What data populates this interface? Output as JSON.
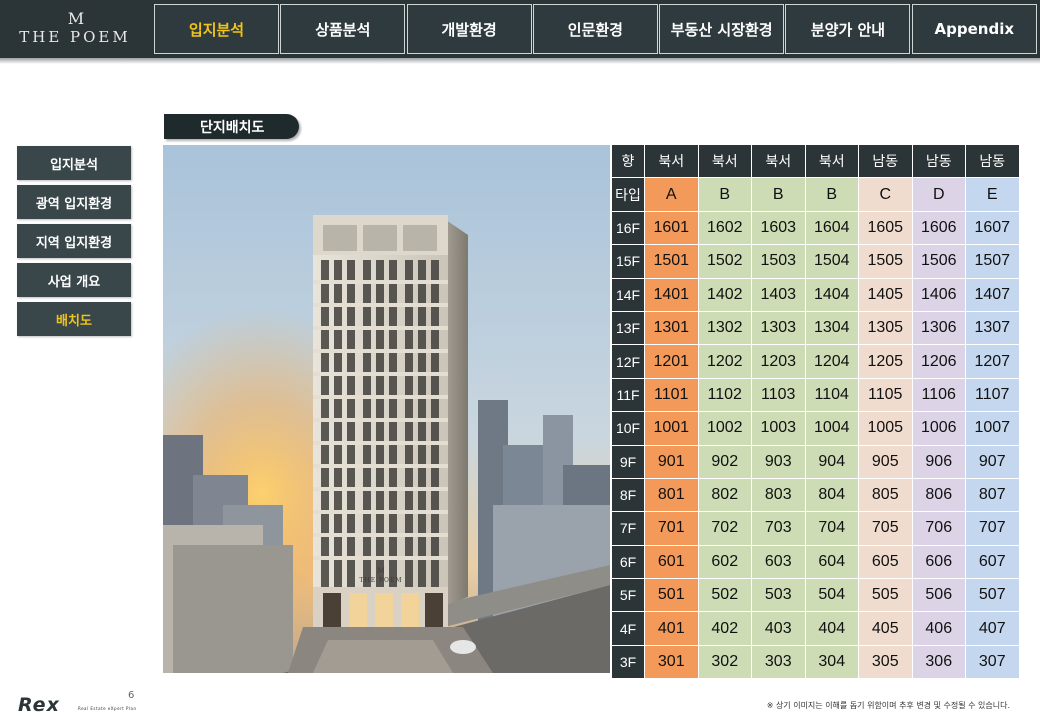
{
  "header": {
    "logo_mark": "M",
    "logo_text": "THE POEM",
    "nav": [
      {
        "label": "입지분석",
        "active": true
      },
      {
        "label": "상품분석",
        "active": false
      },
      {
        "label": "개발환경",
        "active": false
      },
      {
        "label": "인문환경",
        "active": false
      },
      {
        "label": "부동산 시장환경",
        "active": false
      },
      {
        "label": "분양가 안내",
        "active": false
      },
      {
        "label": "Appendix",
        "active": false
      }
    ]
  },
  "sidebar": {
    "items": [
      {
        "label": "입지분석",
        "active": false
      },
      {
        "label": "광역 입지환경",
        "active": false
      },
      {
        "label": "지역 입지환경",
        "active": false
      },
      {
        "label": "사업 개요",
        "active": false
      },
      {
        "label": "배치도",
        "active": true
      }
    ]
  },
  "section_title": "단지배치도",
  "photo": {
    "building_sign_mark": "M",
    "building_sign": "THE POEM"
  },
  "table": {
    "direction_label": "향",
    "type_label": "타입",
    "directions": [
      "북서",
      "북서",
      "북서",
      "북서",
      "남동",
      "남동",
      "남동"
    ],
    "types": [
      "A",
      "B",
      "B",
      "B",
      "C",
      "D",
      "E"
    ],
    "type_colors": {
      "A": "#f39a5a",
      "B": "#cddcb5",
      "C": "#f0dccf",
      "D": "#dcd4e6",
      "E": "#c4d7ef"
    },
    "floors": [
      {
        "floor": "16F",
        "units": [
          "1601",
          "1602",
          "1603",
          "1604",
          "1605",
          "1606",
          "1607"
        ]
      },
      {
        "floor": "15F",
        "units": [
          "1501",
          "1502",
          "1503",
          "1504",
          "1505",
          "1506",
          "1507"
        ]
      },
      {
        "floor": "14F",
        "units": [
          "1401",
          "1402",
          "1403",
          "1404",
          "1405",
          "1406",
          "1407"
        ]
      },
      {
        "floor": "13F",
        "units": [
          "1301",
          "1302",
          "1303",
          "1304",
          "1305",
          "1306",
          "1307"
        ]
      },
      {
        "floor": "12F",
        "units": [
          "1201",
          "1202",
          "1203",
          "1204",
          "1205",
          "1206",
          "1207"
        ]
      },
      {
        "floor": "11F",
        "units": [
          "1101",
          "1102",
          "1103",
          "1104",
          "1105",
          "1106",
          "1107"
        ]
      },
      {
        "floor": "10F",
        "units": [
          "1001",
          "1002",
          "1003",
          "1004",
          "1005",
          "1006",
          "1007"
        ]
      },
      {
        "floor": "9F",
        "units": [
          "901",
          "902",
          "903",
          "904",
          "905",
          "906",
          "907"
        ]
      },
      {
        "floor": "8F",
        "units": [
          "801",
          "802",
          "803",
          "804",
          "805",
          "806",
          "807"
        ]
      },
      {
        "floor": "7F",
        "units": [
          "701",
          "702",
          "703",
          "704",
          "705",
          "706",
          "707"
        ]
      },
      {
        "floor": "6F",
        "units": [
          "601",
          "602",
          "603",
          "604",
          "605",
          "606",
          "607"
        ]
      },
      {
        "floor": "5F",
        "units": [
          "501",
          "502",
          "503",
          "504",
          "505",
          "506",
          "507"
        ]
      },
      {
        "floor": "4F",
        "units": [
          "401",
          "402",
          "403",
          "404",
          "405",
          "406",
          "407"
        ]
      },
      {
        "floor": "3F",
        "units": [
          "301",
          "302",
          "303",
          "304",
          "305",
          "306",
          "307"
        ]
      }
    ]
  },
  "footer": {
    "brand": "Rex",
    "brand_sub": "Real Estate eXpert Plan",
    "page_number": "6",
    "note": "※ 상기 이미지는 이해를 돕기 위함이며 추후 변경 및 수정될 수 있습니다."
  }
}
